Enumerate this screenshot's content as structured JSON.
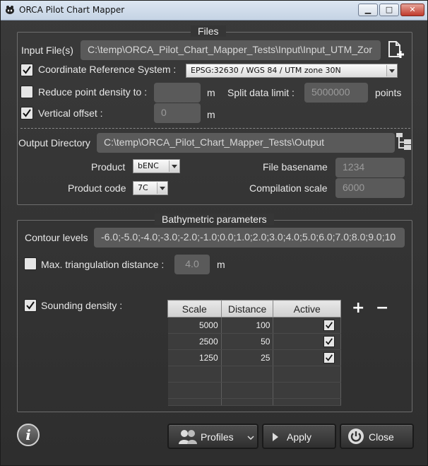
{
  "window": {
    "title": "ORCA Pilot Chart Mapper",
    "min_glyph": "▁",
    "max_glyph": "□",
    "close_glyph": "✕"
  },
  "files": {
    "group_title": "Files",
    "input_label": "Input File(s)",
    "input_value": "C:\\temp\\ORCA_Pilot_Chart_Mapper_Tests\\Input\\Input_UTM_Zor",
    "crs_label": "Coordinate Reference System :",
    "crs_checked": true,
    "crs_value": "EPSG:32630 / WGS 84 / UTM zone 30N",
    "reduce_label": "Reduce point density to :",
    "reduce_checked": false,
    "reduce_value": "",
    "reduce_unit": "m",
    "split_label": "Split data limit :",
    "split_value": "5000000",
    "split_unit": "points",
    "vertical_label": "Vertical offset :",
    "vertical_checked": true,
    "vertical_value": "0",
    "vertical_unit": "m",
    "output_label": "Output Directory",
    "output_value": "C:\\temp\\ORCA_Pilot_Chart_Mapper_Tests\\Output",
    "product_label": "Product",
    "product_value": "bENC",
    "product_code_label": "Product code",
    "product_code_value": "7C",
    "basename_label": "File basename",
    "basename_value": "1234",
    "compilation_label": "Compilation scale",
    "compilation_value": "6000"
  },
  "bathy": {
    "group_title": "Bathymetric parameters",
    "contour_label": "Contour levels",
    "contour_value": "-6.0;-5.0;-4.0;-3.0;-2.0;-1.0;0.0;1.0;2.0;3.0;4.0;5.0;6.0;7.0;8.0;9.0;10",
    "max_tri_label": "Max. triangulation distance :",
    "max_tri_checked": false,
    "max_tri_value": "4.0",
    "max_tri_unit": "m",
    "sounding_label": "Sounding density :",
    "sounding_checked": true,
    "table": {
      "headers": [
        "Scale",
        "Distance",
        "Active"
      ],
      "rows": [
        {
          "scale": "5000",
          "distance": "100",
          "active": true
        },
        {
          "scale": "2500",
          "distance": "50",
          "active": true
        },
        {
          "scale": "1250",
          "distance": "25",
          "active": true
        }
      ]
    },
    "add_glyph": "+",
    "remove_glyph": "−"
  },
  "footer": {
    "info_glyph": "i",
    "profiles_label": "Profiles",
    "apply_label": "Apply",
    "close_label": "Close"
  }
}
